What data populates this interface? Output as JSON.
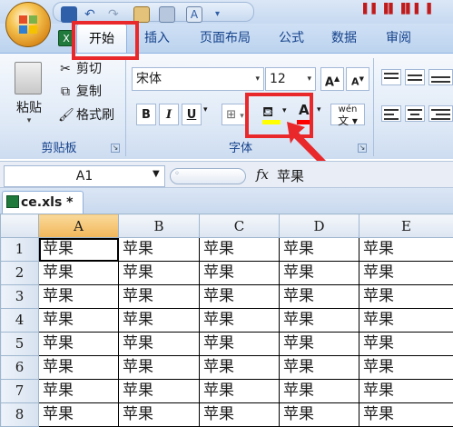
{
  "ribbon": {
    "tabs": [
      "开始",
      "插入",
      "页面布局",
      "公式",
      "数据",
      "审阅"
    ],
    "active_tab": "开始",
    "clipboard": {
      "paste": "粘贴",
      "cut": "剪切",
      "copy": "复制",
      "format_painter": "格式刷",
      "group_label": "剪贴板"
    },
    "font": {
      "font_name": "宋体",
      "font_size": "12",
      "bold": "B",
      "italic": "I",
      "underline": "U",
      "grow": "A",
      "shrink": "A",
      "font_color": "A",
      "phonetic": "wén",
      "group_label": "字体",
      "fill_color": "#ffff00",
      "text_color": "#ff0000"
    }
  },
  "formula_bar": {
    "name_box": "A1",
    "fx": "fx",
    "value": "苹果"
  },
  "workbook": {
    "tab": "ce.xls *"
  },
  "sheet": {
    "columns": [
      "A",
      "B",
      "C",
      "D",
      "E"
    ],
    "rows": [
      {
        "num": "1",
        "cells": [
          "苹果",
          "苹果",
          "苹果",
          "苹果",
          "苹果"
        ]
      },
      {
        "num": "2",
        "cells": [
          "苹果",
          "苹果",
          "苹果",
          "苹果",
          "苹果"
        ]
      },
      {
        "num": "3",
        "cells": [
          "苹果",
          "苹果",
          "苹果",
          "苹果",
          "苹果"
        ]
      },
      {
        "num": "4",
        "cells": [
          "苹果",
          "苹果",
          "苹果",
          "苹果",
          "苹果"
        ]
      },
      {
        "num": "5",
        "cells": [
          "苹果",
          "苹果",
          "苹果",
          "苹果",
          "苹果"
        ]
      },
      {
        "num": "6",
        "cells": [
          "苹果",
          "苹果",
          "苹果",
          "苹果",
          "苹果"
        ]
      },
      {
        "num": "7",
        "cells": [
          "苹果",
          "苹果",
          "苹果",
          "苹果",
          "苹果"
        ]
      },
      {
        "num": "8",
        "cells": [
          "苹果",
          "苹果",
          "苹果",
          "苹果",
          "苹果"
        ]
      }
    ]
  },
  "colors": {
    "annotation": "#e8282b",
    "selected_header": "#f2b75a"
  }
}
